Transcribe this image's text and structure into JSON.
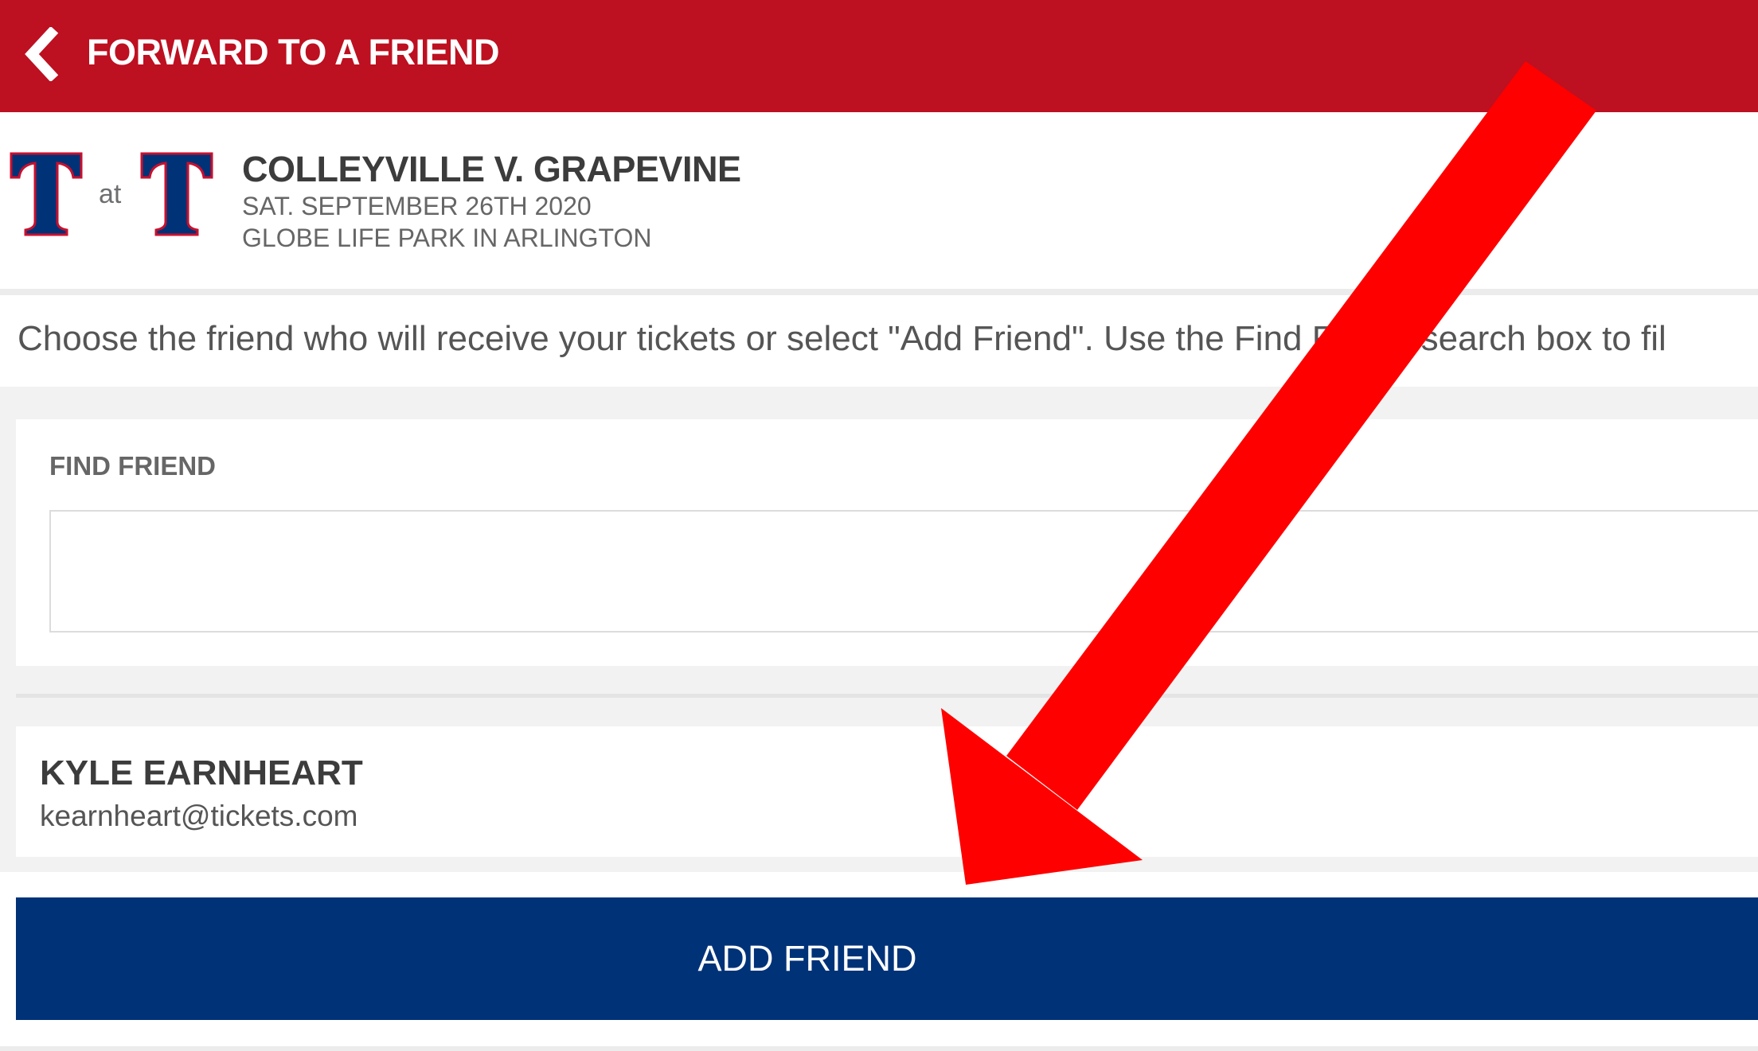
{
  "header": {
    "title": "FORWARD TO A FRIEND",
    "background": "#bd1021"
  },
  "event": {
    "title": "COLLEYVILLE V. GRAPEVINE",
    "date": "SAT. SEPTEMBER 26TH 2020",
    "venue": "GLOBE LIFE PARK IN ARLINGTON",
    "separator": "at",
    "logo_icon": "team-t-logo"
  },
  "instructions": {
    "text": "Choose the friend who will receive your tickets or select \"Add Friend\". Use the Find Friend search box to fil"
  },
  "find_friend": {
    "label": "FIND FRIEND",
    "value": "",
    "placeholder": ""
  },
  "friends": [
    {
      "name": "KYLE EARNHEART",
      "email": "kearnheart@tickets.com"
    }
  ],
  "actions": {
    "add_friend_label": "ADD FRIEND",
    "button_color": "#003278"
  },
  "annotation": {
    "type": "red-arrow",
    "color": "#ff0000"
  }
}
